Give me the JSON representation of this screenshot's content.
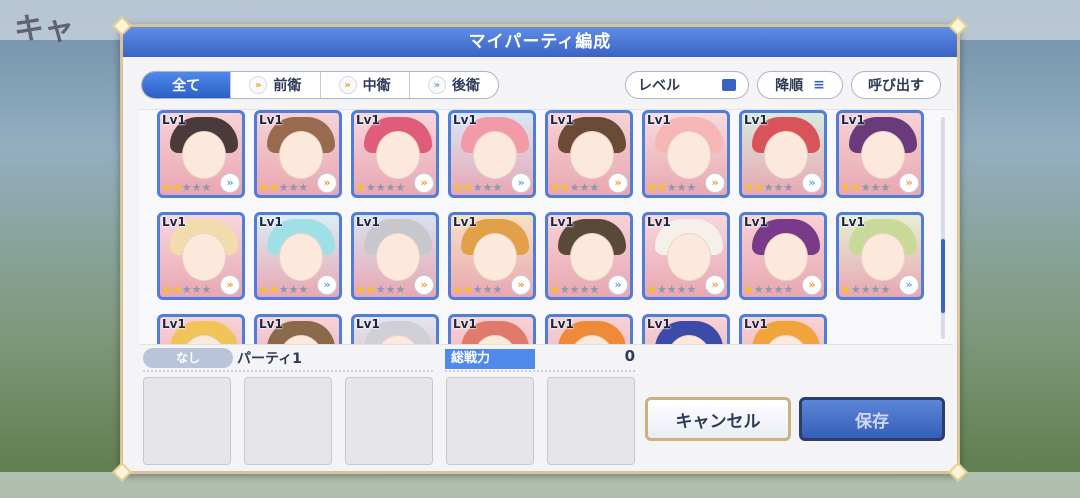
{
  "background": {
    "title": "キャ"
  },
  "dialog": {
    "title": "マイパーティ編成"
  },
  "tabs": [
    {
      "label": "全て",
      "active": true
    },
    {
      "label": "前衛",
      "active": false
    },
    {
      "label": "中衛",
      "active": false
    },
    {
      "label": "後衛",
      "active": false
    }
  ],
  "sort": {
    "level_label": "レベル",
    "order_label": "降順",
    "call_label": "呼び出す"
  },
  "cards": [
    {
      "lv": "Lv1",
      "stars": 2,
      "role": "»",
      "hair": "#4a3a3a",
      "bg": "#f6d2d6"
    },
    {
      "lv": "Lv1",
      "stars": 2,
      "role": "»",
      "hair": "#9a6a4e",
      "bg": "#f6d2d6"
    },
    {
      "lv": "Lv1",
      "stars": 1,
      "role": "»",
      "hair": "#e05d7a",
      "bg": "#f7d6de"
    },
    {
      "lv": "Lv1",
      "stars": 2,
      "role": "»",
      "hair": "#f29aa8",
      "bg": "#d9e6fa"
    },
    {
      "lv": "Lv1",
      "stars": 2,
      "role": "»",
      "hair": "#6b4a36",
      "bg": "#f6d2d6"
    },
    {
      "lv": "Lv1",
      "stars": 2,
      "role": "»",
      "hair": "#f6b6b6",
      "bg": "#f7dce0"
    },
    {
      "lv": "Lv1",
      "stars": 2,
      "role": "»",
      "hair": "#d9545a",
      "bg": "#d7eadc"
    },
    {
      "lv": "Lv1",
      "stars": 2,
      "role": "»",
      "hair": "#6a3a7a",
      "bg": "#f6d2d6"
    },
    {
      "lv": "Lv1",
      "stars": 2,
      "role": "»",
      "hair": "#f2dcae",
      "bg": "#f7d6de"
    },
    {
      "lv": "Lv1",
      "stars": 2,
      "role": "»",
      "hair": "#9fe0e6",
      "bg": "#dbeef5"
    },
    {
      "lv": "Lv1",
      "stars": 2,
      "role": "»",
      "hair": "#c8c8cc",
      "bg": "#d9e2f2"
    },
    {
      "lv": "Lv1",
      "stars": 2,
      "role": "»",
      "hair": "#e2a048",
      "bg": "#f6e2c2"
    },
    {
      "lv": "Lv1",
      "stars": 1,
      "role": "»",
      "hair": "#5a4838",
      "bg": "#f6d2d6"
    },
    {
      "lv": "Lv1",
      "stars": 1,
      "role": "»",
      "hair": "#f5f0ea",
      "bg": "#f7d6de"
    },
    {
      "lv": "Lv1",
      "stars": 1,
      "role": "»",
      "hair": "#7a3a8a",
      "bg": "#f6d2d6"
    },
    {
      "lv": "Lv1",
      "stars": 1,
      "role": "»",
      "hair": "#c9d99a",
      "bg": "#e6f0d6"
    },
    {
      "lv": "Lv1",
      "stars": 0,
      "role": "",
      "hair": "#f1c45a",
      "bg": "#f6d2d6"
    },
    {
      "lv": "Lv1",
      "stars": 0,
      "role": "",
      "hair": "#8a6a4a",
      "bg": "#f6d2d6"
    },
    {
      "lv": "Lv1",
      "stars": 0,
      "role": "",
      "hair": "#cfcfd6",
      "bg": "#e2e6ef"
    },
    {
      "lv": "Lv1",
      "stars": 0,
      "role": "",
      "hair": "#e07a6a",
      "bg": "#f6d2d6"
    },
    {
      "lv": "Lv1",
      "stars": 0,
      "role": "",
      "hair": "#ef8a3a",
      "bg": "#f6d2d6"
    },
    {
      "lv": "Lv1",
      "stars": 0,
      "role": "",
      "hair": "#3c4aa8",
      "bg": "#f6d2d6"
    },
    {
      "lv": "Lv1",
      "stars": 0,
      "role": "",
      "hair": "#f2a43c",
      "bg": "#f6d2d6"
    }
  ],
  "party": {
    "badge": "なし",
    "name": "パーティ1",
    "power_label": "総戦力",
    "power_value": "0"
  },
  "buttons": {
    "cancel": "キャンセル",
    "save": "保存"
  }
}
